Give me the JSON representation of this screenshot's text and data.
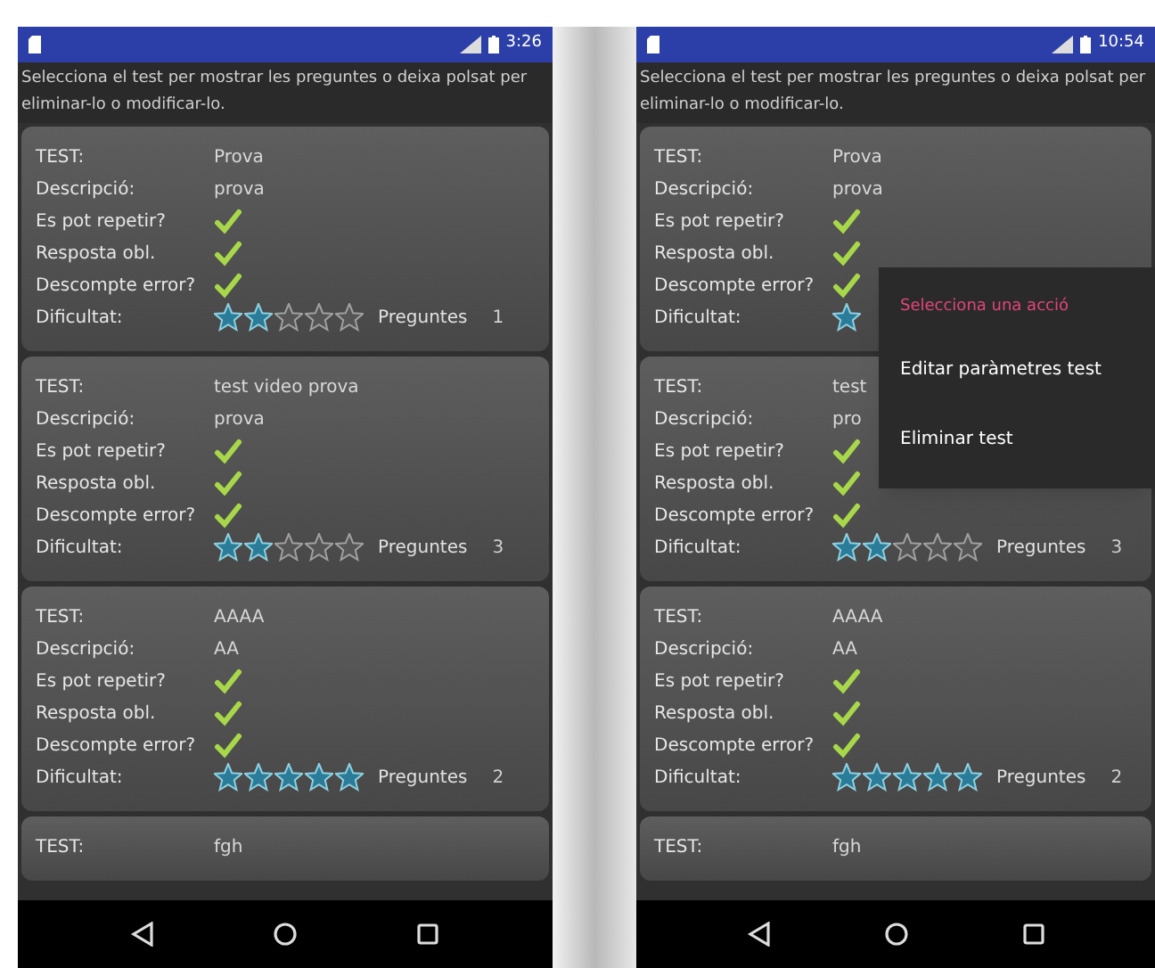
{
  "phones": [
    {
      "status_bar": {
        "time": "3:26"
      },
      "instructions": "Selecciona el test per mostrar les preguntes o deixa polsat per eliminar-lo o modificar-lo.",
      "cards": [
        {
          "rows": [
            {
              "kind": "text",
              "label": "TEST:",
              "value": "Prova"
            },
            {
              "kind": "text",
              "label": "Descripció:",
              "value": "prova"
            },
            {
              "kind": "check",
              "label": "Es pot repetir?",
              "checked": true
            },
            {
              "kind": "check",
              "label": "Resposta obl.",
              "checked": true
            },
            {
              "kind": "check",
              "label": "Descompte error?",
              "checked": true
            },
            {
              "kind": "rating",
              "label": "Dificultat:",
              "stars": 2,
              "questions_label": "Preguntes",
              "questions": "1"
            }
          ]
        },
        {
          "rows": [
            {
              "kind": "text",
              "label": "TEST:",
              "value": "test video prova"
            },
            {
              "kind": "text",
              "label": "Descripció:",
              "value": "prova"
            },
            {
              "kind": "check",
              "label": "Es pot repetir?",
              "checked": true
            },
            {
              "kind": "check",
              "label": "Resposta obl.",
              "checked": true
            },
            {
              "kind": "check",
              "label": "Descompte error?",
              "checked": true
            },
            {
              "kind": "rating",
              "label": "Dificultat:",
              "stars": 2,
              "questions_label": "Preguntes",
              "questions": "3"
            }
          ]
        },
        {
          "rows": [
            {
              "kind": "text",
              "label": "TEST:",
              "value": "AAAA"
            },
            {
              "kind": "text",
              "label": "Descripció:",
              "value": "AA"
            },
            {
              "kind": "check",
              "label": "Es pot repetir?",
              "checked": true
            },
            {
              "kind": "check",
              "label": "Resposta obl.",
              "checked": true
            },
            {
              "kind": "check",
              "label": "Descompte error?",
              "checked": true
            },
            {
              "kind": "rating",
              "label": "Dificultat:",
              "stars": 5,
              "questions_label": "Preguntes",
              "questions": "2"
            }
          ]
        },
        {
          "rows": [
            {
              "kind": "text",
              "label": "TEST:",
              "value": "fgh"
            }
          ]
        }
      ]
    },
    {
      "status_bar": {
        "time": "10:54"
      },
      "instructions": "Selecciona el test per mostrar les preguntes o deixa polsat per eliminar-lo o modificar-lo.",
      "cards": [
        {
          "rows": [
            {
              "kind": "text",
              "label": "TEST:",
              "value": "Prova"
            },
            {
              "kind": "text",
              "label": "Descripció:",
              "value": "prova"
            },
            {
              "kind": "check",
              "label": "Es pot repetir?",
              "checked": true
            },
            {
              "kind": "check",
              "label": "Resposta obl.",
              "checked": true
            },
            {
              "kind": "check",
              "label": "Descompte error?",
              "checked": true
            },
            {
              "kind": "rating",
              "label": "Dificultat:"
            }
          ]
        },
        {
          "rows": [
            {
              "kind": "text",
              "label": "TEST:",
              "value": "test"
            },
            {
              "kind": "text",
              "label": "Descripció:",
              "value": "pro"
            },
            {
              "kind": "check",
              "label": "Es pot repetir?",
              "checked": true
            },
            {
              "kind": "check",
              "label": "Resposta obl.",
              "checked": true
            },
            {
              "kind": "check",
              "label": "Descompte error?",
              "checked": true
            },
            {
              "kind": "rating",
              "label": "Dificultat:",
              "stars": 2,
              "questions_label": "Preguntes",
              "questions": "3"
            }
          ]
        },
        {
          "rows": [
            {
              "kind": "text",
              "label": "TEST:",
              "value": "AAAA"
            },
            {
              "kind": "text",
              "label": "Descripció:",
              "value": "AA"
            },
            {
              "kind": "check",
              "label": "Es pot repetir?",
              "checked": true
            },
            {
              "kind": "check",
              "label": "Resposta obl.",
              "checked": true
            },
            {
              "kind": "check",
              "label": "Descompte error?",
              "checked": true
            },
            {
              "kind": "rating",
              "label": "Dificultat:",
              "stars": 5,
              "questions_label": "Preguntes",
              "questions": "2"
            }
          ]
        },
        {
          "rows": [
            {
              "kind": "text",
              "label": "TEST:",
              "value": "fgh"
            }
          ]
        }
      ],
      "menu": {
        "title": "Selecciona una acció",
        "items": [
          "Editar paràmetres test",
          "Eliminar test"
        ]
      }
    }
  ]
}
